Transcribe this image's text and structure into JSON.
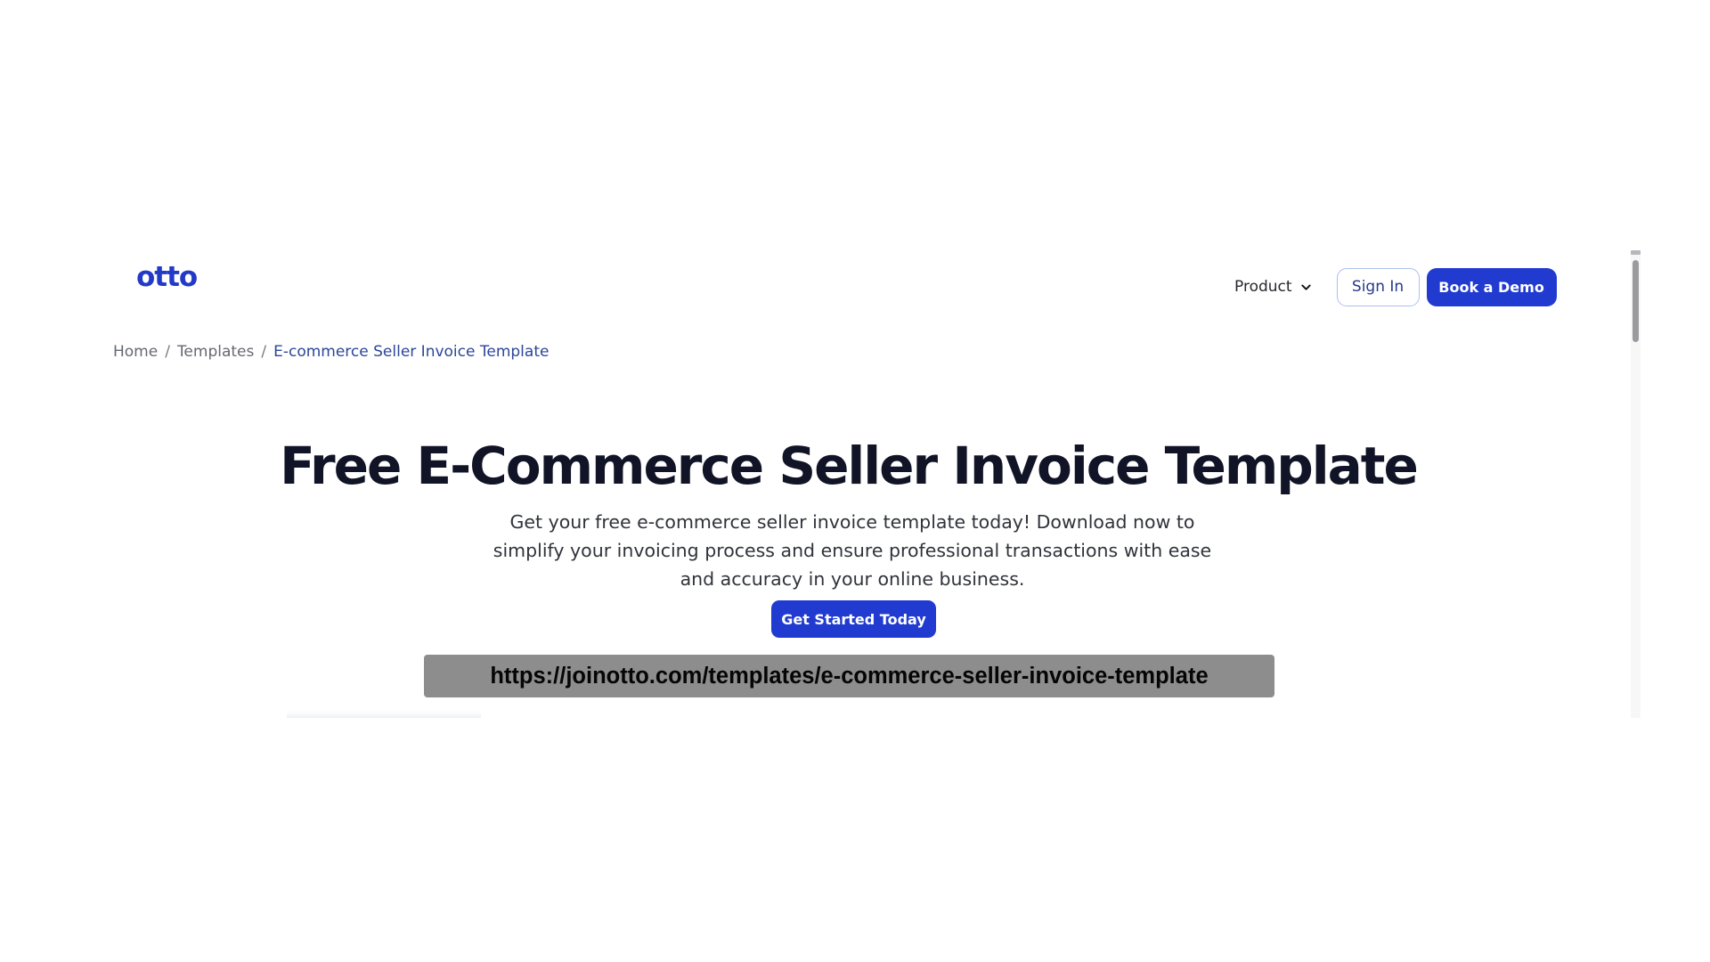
{
  "brand": {
    "logo_text": "otto",
    "brand_color": "#2339c8"
  },
  "navigation": {
    "product_label": "Product",
    "sign_in_label": "Sign In",
    "book_demo_label": "Book a Demo"
  },
  "breadcrumb": {
    "items": [
      "Home",
      "Templates",
      "E-commerce Seller Invoice Template"
    ],
    "separator": "/"
  },
  "hero": {
    "title": "Free E-Commerce Seller Invoice Template",
    "description": "Get your free e-commerce seller invoice template today! Download now to simplify your invoicing process and ensure professional transactions with ease and accuracy in your online business.",
    "cta_label": "Get Started Today"
  },
  "overlay": {
    "url": "https://joinotto.com/templates/e-commerce-seller-invoice-template"
  },
  "colors": {
    "primary": "#213bd0",
    "title": "#111426",
    "breadcrumb_active": "#2c4699",
    "url_bar": "#8d8d8d"
  },
  "icons": {
    "product_dropdown": "chevron-down-icon"
  }
}
